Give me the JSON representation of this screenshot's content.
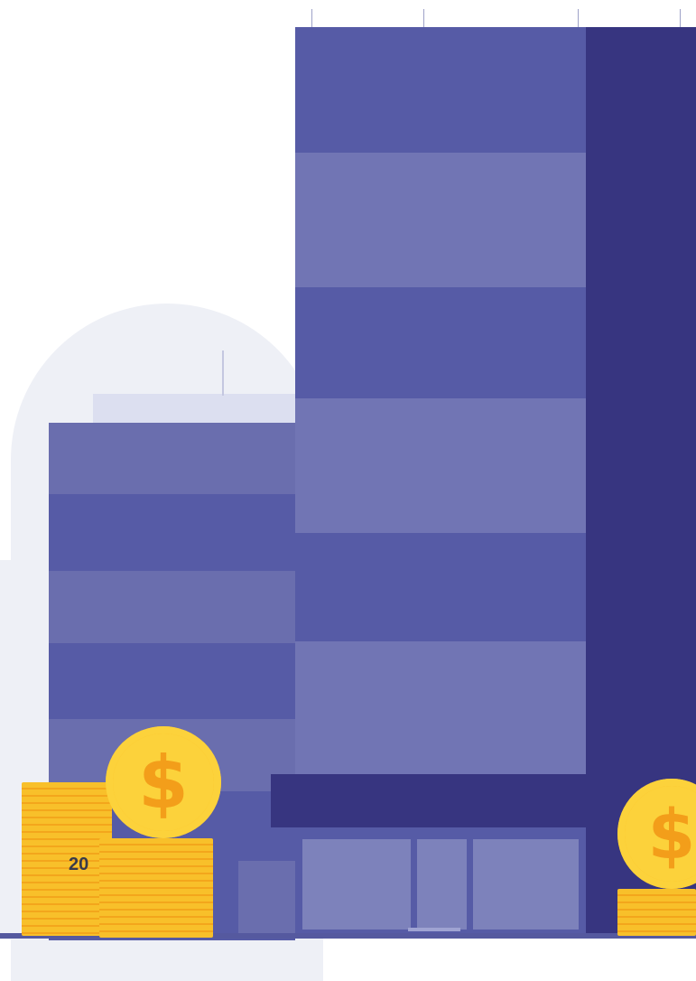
{
  "scene": {
    "coin_symbol": "$",
    "stack_label": "20"
  },
  "colors": {
    "background": "#ffffff",
    "cloud": "#eef0f6",
    "tower_front_dark": "#565ba6",
    "tower_front_light": "#7175b4",
    "tower_side": "#373580",
    "small_building_dark": "#565ba6",
    "small_building_light": "#6a6eae",
    "coin_gold": "#fcd23b",
    "coin_shadow": "#f3a61c"
  },
  "icons": [
    "dollar-coin-icon",
    "coin-stack-icon",
    "building-icon"
  ]
}
